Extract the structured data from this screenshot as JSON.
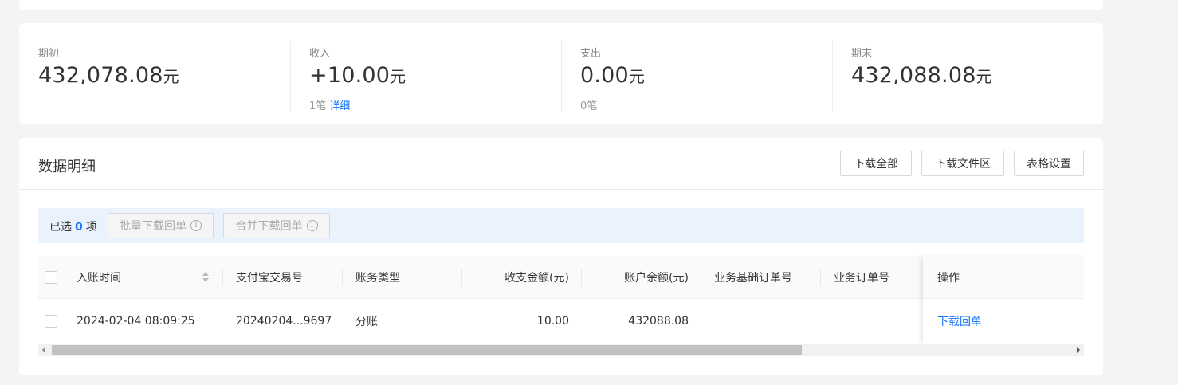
{
  "summary": {
    "opening": {
      "label": "期初",
      "amount": "432,078.08",
      "unit": "元"
    },
    "income": {
      "label": "收入",
      "amount": "+10.00",
      "unit": "元",
      "count": "1笔",
      "detail_link": "详细"
    },
    "expense": {
      "label": "支出",
      "amount": "0.00",
      "unit": "元",
      "count": "0笔"
    },
    "closing": {
      "label": "期末",
      "amount": "432,088.08",
      "unit": "元"
    }
  },
  "detail": {
    "title": "数据明细",
    "buttons": {
      "download_all": "下载全部",
      "download_area": "下载文件区",
      "table_settings": "表格设置"
    },
    "selection": {
      "prefix": "已选",
      "count": "0",
      "suffix": "项",
      "batch_download": "批量下载回单",
      "merge_download": "合并下载回单"
    },
    "table": {
      "columns": [
        "入账时间",
        "支付宝交易号",
        "账务类型",
        "收支金额(元)",
        "账户余额(元)",
        "业务基础订单号",
        "业务订单号",
        "操作"
      ],
      "rows": [
        {
          "time": "2024-02-04 08:09:25",
          "trade_no": "20240204...9697",
          "type": "分账",
          "amount": "10.00",
          "balance": "432088.08",
          "base_order": "",
          "order": "",
          "action": "下载回单"
        }
      ]
    },
    "scroll_fraction": 0.0
  },
  "colors": {
    "accent": "#1677ff",
    "selbar": "#eaf2fd"
  }
}
